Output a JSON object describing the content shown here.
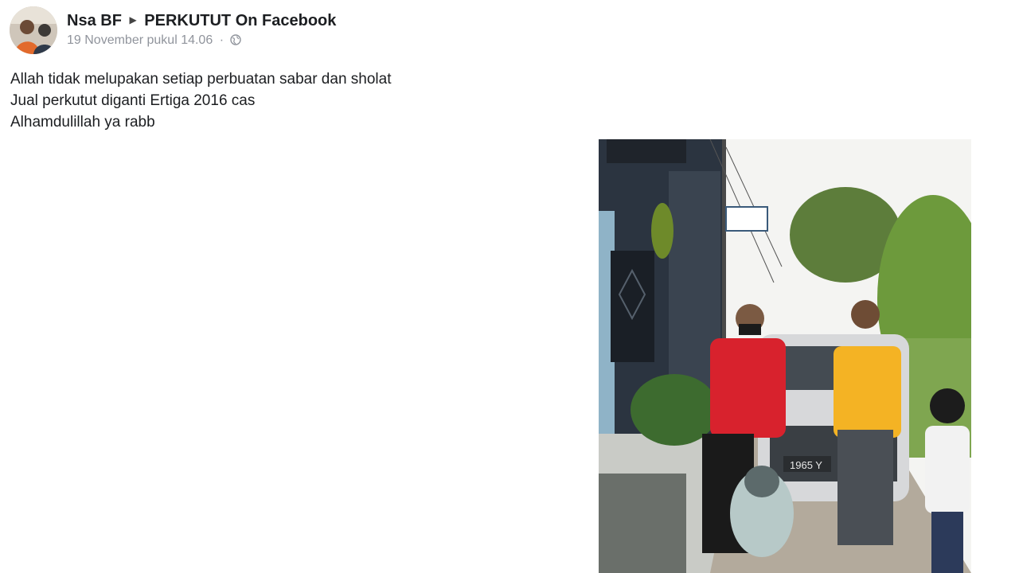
{
  "post": {
    "author": "Nsa BF",
    "group": "PERKUTUT On Facebook",
    "timestamp": "19 November pukul 14.06",
    "separator": "·",
    "privacy_icon": "globe-icon",
    "lines": [
      "Allah tidak melupakan setiap perbuatan sabar dan sholat",
      "Jual perkutut diganti Ertiga 2016 cas",
      "Alhamdulillah ya rabb"
    ],
    "photo": {
      "sign_text": "",
      "plate_text": "1965 Y"
    }
  }
}
